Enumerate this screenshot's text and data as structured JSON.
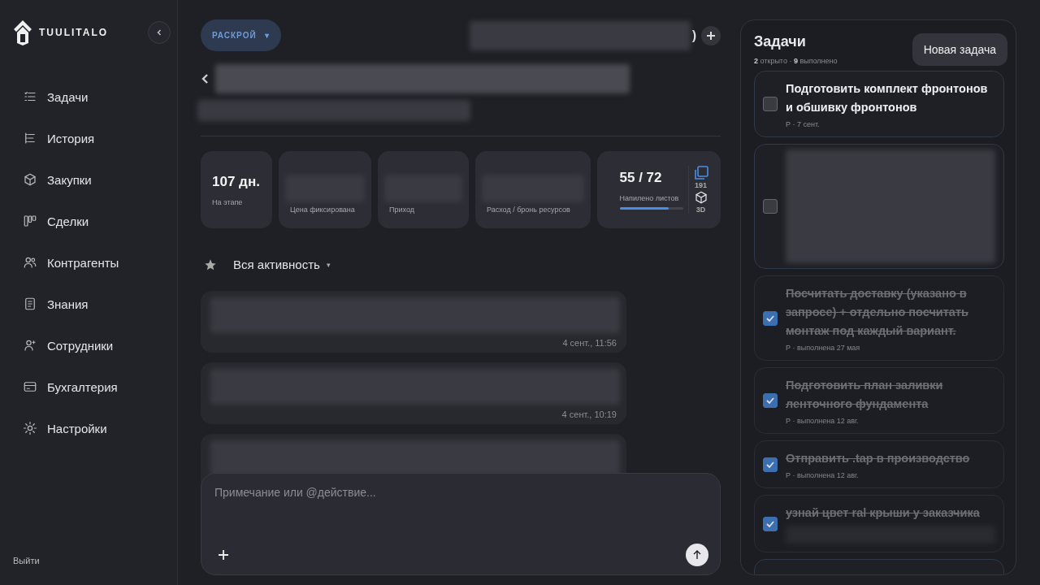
{
  "brand": {
    "name": "TUULITALO"
  },
  "sidebar": {
    "items": [
      {
        "label": "Задачи"
      },
      {
        "label": "История"
      },
      {
        "label": "Закупки"
      },
      {
        "label": "Сделки"
      },
      {
        "label": "Контрагенты"
      },
      {
        "label": "Знания"
      },
      {
        "label": "Сотрудники"
      },
      {
        "label": "Бухгалтерия"
      },
      {
        "label": "Настройки"
      }
    ],
    "logout": "Выйти"
  },
  "header": {
    "stage": "РАСКРОЙ",
    "stage_caret": "▾",
    "tail": ")"
  },
  "stats": [
    {
      "kind": "value",
      "value": "107 дн.",
      "label": "На этапе"
    },
    {
      "kind": "blurred",
      "label": "Цена фиксирована"
    },
    {
      "kind": "blurred",
      "label": "Приход"
    },
    {
      "kind": "blurred",
      "label": "Расход / бронь ресурсов"
    },
    {
      "kind": "progress",
      "value": "55 / 72",
      "label": "Напилено листов",
      "level": 0.78
    }
  ],
  "side_stats": [
    {
      "label": "191"
    },
    {
      "label": "3D"
    }
  ],
  "filter": {
    "label": "Вся активность",
    "caret": "▾"
  },
  "activity": [
    {
      "time": "4 сент., 11:56"
    },
    {
      "time": "4 сент., 10:19"
    }
  ],
  "composer": {
    "placeholder": "Примечание или @действие..."
  },
  "tasks_panel": {
    "title": "Задачи",
    "summary": "**2** открыто · **9** выполнено",
    "new_button": "Новая задача",
    "tasks": [
      {
        "kind": "text",
        "checked": false,
        "title": "Подготовить комплект фронтонов и обшивку фронтонов",
        "meta": "Р · 7 сент."
      },
      {
        "kind": "blurred",
        "checked": false
      },
      {
        "kind": "text",
        "checked": true,
        "title": "Посчитать доставку (указано в запросе) + отдельно посчитать монтаж под каждый вариант.",
        "meta": "Р · выполнена 27 мая"
      },
      {
        "kind": "text",
        "checked": true,
        "title": "Подготовить план заливки ленточного фундамента",
        "meta": "Р · выполнена 12 авг."
      },
      {
        "kind": "text",
        "checked": true,
        "title": "Отправить .tap в производство",
        "meta": "Р · выполнена 12 авг."
      },
      {
        "kind": "text",
        "checked": true,
        "title": "узнай цвет ral крыши у заказчика"
      },
      {
        "kind": "cut"
      }
    ]
  }
}
